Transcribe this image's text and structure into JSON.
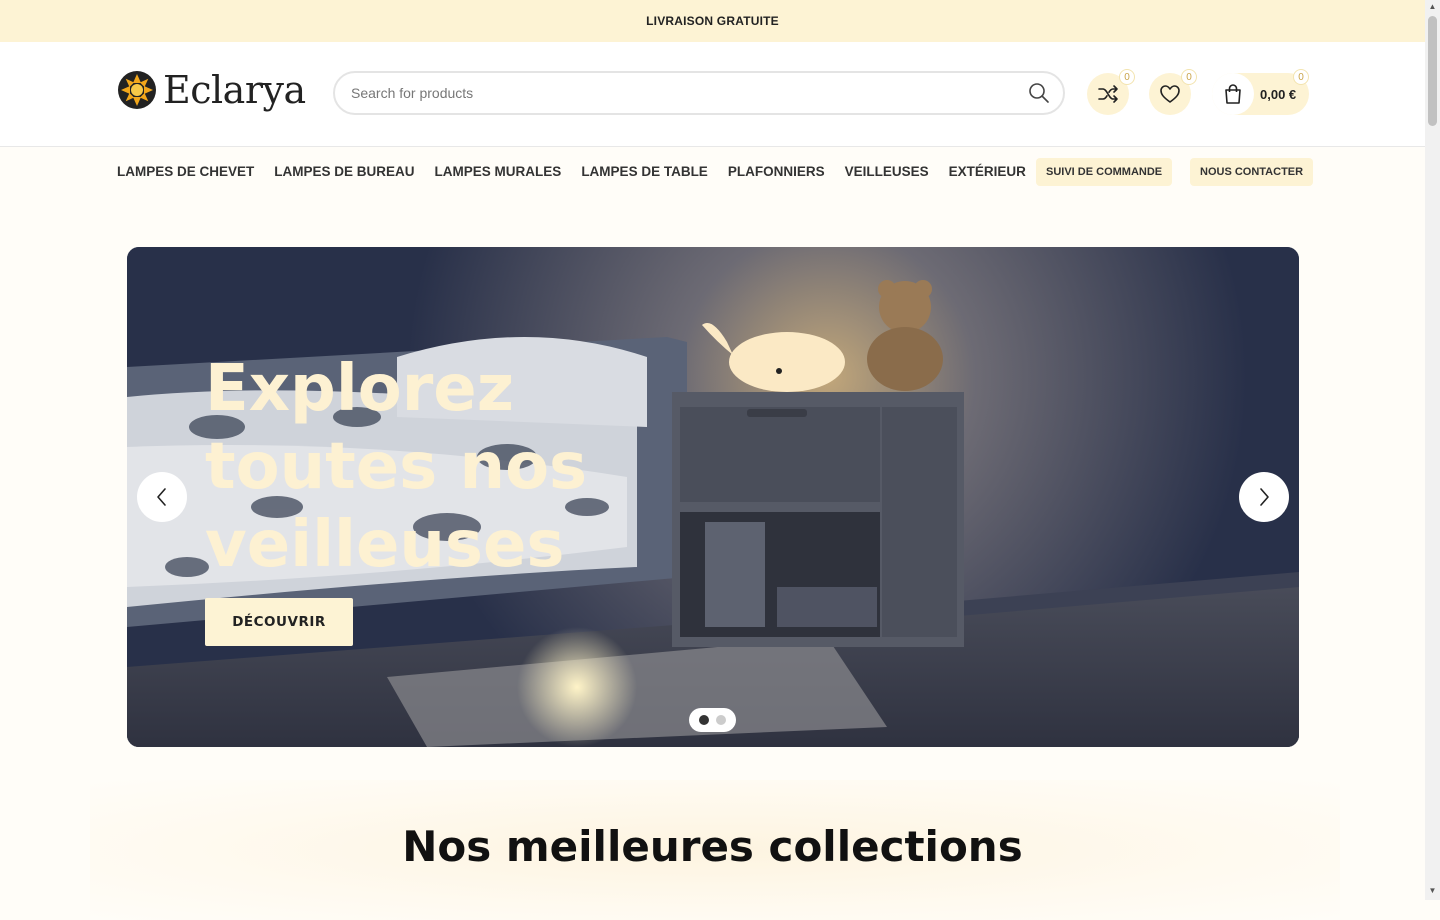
{
  "topbar": {
    "text": "LIVRAISON GRATUITE"
  },
  "header": {
    "logo_text": "Eclarya",
    "search_placeholder": "Search for products",
    "compare_count": "0",
    "wishlist_count": "0",
    "cart_count": "0",
    "cart_total": "0,00 €"
  },
  "nav": {
    "items": [
      {
        "label": "LAMPES DE CHEVET"
      },
      {
        "label": "LAMPES DE BUREAU"
      },
      {
        "label": "LAMPES MURALES"
      },
      {
        "label": "LAMPES DE TABLE"
      },
      {
        "label": "PLAFONNIERS"
      },
      {
        "label": "VEILLEUSES"
      },
      {
        "label": "EXTÉRIEUR"
      }
    ],
    "order_tracking": "SUIVI DE COMMANDE",
    "contact": "NOUS CONTACTER"
  },
  "hero": {
    "title": "Explorez toutes nos veilleuses",
    "button": "DÉCOUVRIR",
    "slide_count": 2,
    "active_slide": 1
  },
  "section": {
    "title": "Nos meilleures collections"
  },
  "colors": {
    "accent": "#fdf3d4",
    "hero_text": "#fdf1d2",
    "hero_bg": "#2d3550"
  }
}
